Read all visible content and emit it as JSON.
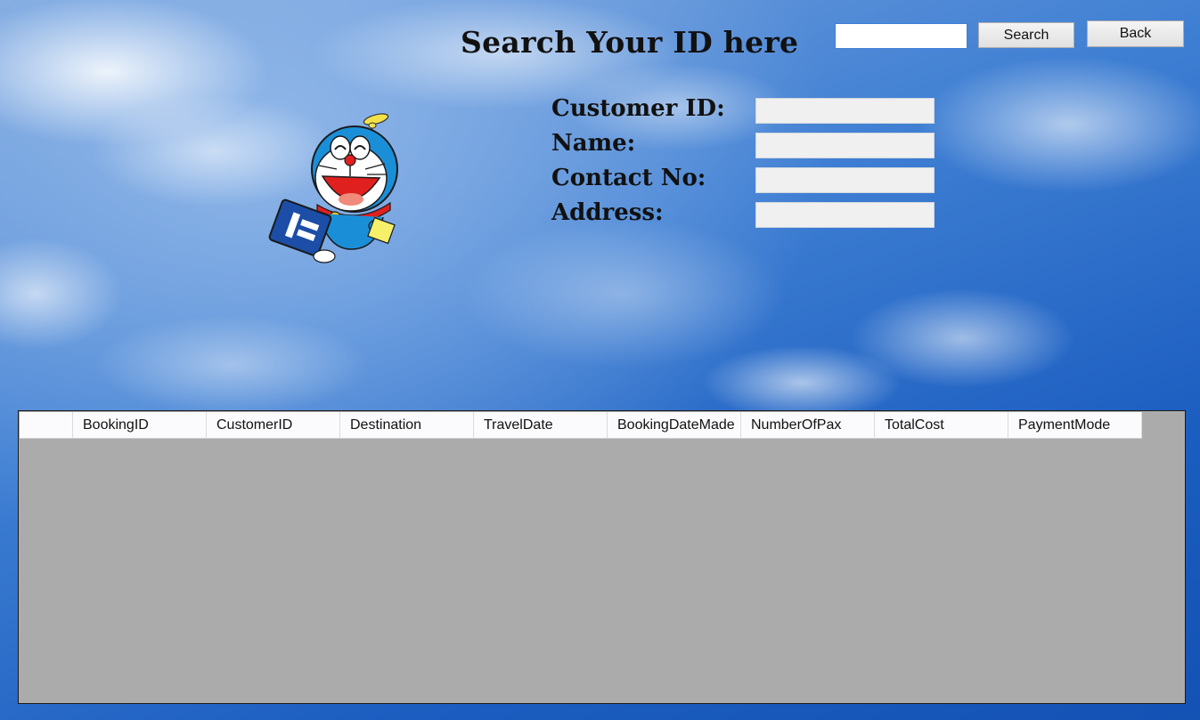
{
  "header": {
    "title": "Search Your ID here",
    "search": {
      "value": "",
      "button_label": "Search"
    },
    "back_label": "Back"
  },
  "details": {
    "customer_id": {
      "label": "Customer ID:",
      "value": ""
    },
    "name": {
      "label": "Name:",
      "value": ""
    },
    "contact_no": {
      "label": "Contact No:",
      "value": ""
    },
    "address": {
      "label": "Address:",
      "value": ""
    }
  },
  "grid": {
    "columns": [
      "BookingID",
      "CustomerID",
      "Destination",
      "TravelDate",
      "BookingDateMade",
      "NumberOfPax",
      "TotalCost",
      "PaymentMode"
    ],
    "rows": []
  },
  "colors": {
    "grid_background": "#ababab",
    "header_background": "#fbfbfd",
    "search_border": "#3c7fd8"
  },
  "icons": {
    "character": "doraemon-illustration"
  }
}
